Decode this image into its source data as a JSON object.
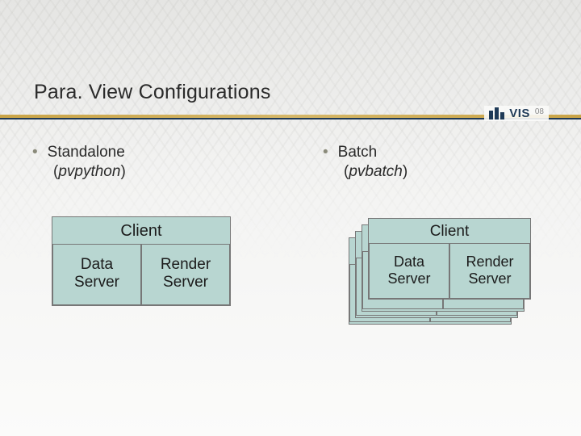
{
  "title": "Para. View Configurations",
  "logo": {
    "name": "VIS",
    "suffix": "08"
  },
  "left": {
    "bullet": "Standalone",
    "tool": "pvpython"
  },
  "right": {
    "bullet": "Batch",
    "tool": "pvbatch"
  },
  "box": {
    "client": "Client",
    "data_server": "Data\nServer",
    "render_server": "Render\nServer"
  }
}
